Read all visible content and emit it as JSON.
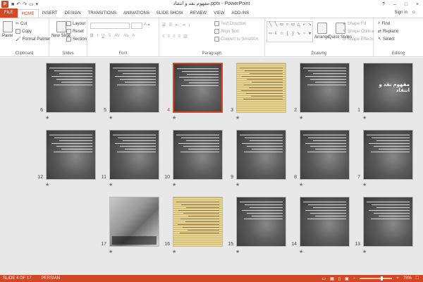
{
  "window": {
    "title": "مفهوم نقد و انتقاد.pptx - PowerPoint",
    "app_letter": "P",
    "controls": [
      "?",
      "–",
      "□",
      "×"
    ]
  },
  "ribbon_tabs": [
    "FILE",
    "HOME",
    "INSERT",
    "DESIGN",
    "TRANSITIONS",
    "ANIMATIONS",
    "SLIDE SHOW",
    "REVIEW",
    "VIEW",
    "ADD-INS"
  ],
  "active_tab": "HOME",
  "account": {
    "signin": "Sign in"
  },
  "clipboard": {
    "label": "Clipboard",
    "paste": "Paste",
    "cut": "Cut",
    "copy": "Copy",
    "format_painter": "Format Painter"
  },
  "slides_group": {
    "label": "Slides",
    "new_slide": "New Slide",
    "layout": "Layout",
    "reset": "Reset",
    "section": "Section"
  },
  "font_group": {
    "label": "Font"
  },
  "paragraph_group": {
    "label": "Paragraph",
    "text_direction": "Text Direction",
    "align_text": "Align Text",
    "convert_smartart": "Convert to SmartArt"
  },
  "drawing_group": {
    "label": "Drawing",
    "arrange": "Arrange",
    "quick_styles": "Quick Styles",
    "shape_fill": "Shape Fill",
    "shape_outline": "Shape Outline",
    "shape_effects": "Shape Effects"
  },
  "editing_group": {
    "label": "Editing",
    "find": "Find",
    "replace": "Replace",
    "select": "Select"
  },
  "slide_title_1": "مفهوم نقد و انتقاد",
  "slides": [
    {
      "n": "1",
      "kind": "title"
    },
    {
      "n": "2",
      "kind": "text"
    },
    {
      "n": "3",
      "kind": "parch"
    },
    {
      "n": "4",
      "kind": "text",
      "selected": true
    },
    {
      "n": "5",
      "kind": "text"
    },
    {
      "n": "6",
      "kind": "text"
    },
    {
      "n": "7",
      "kind": "text"
    },
    {
      "n": "8",
      "kind": "text"
    },
    {
      "n": "9",
      "kind": "text"
    },
    {
      "n": "10",
      "kind": "text"
    },
    {
      "n": "11",
      "kind": "text"
    },
    {
      "n": "12",
      "kind": "text"
    },
    {
      "n": "13",
      "kind": "text"
    },
    {
      "n": "14",
      "kind": "text"
    },
    {
      "n": "15",
      "kind": "text"
    },
    {
      "n": "16",
      "kind": "parch"
    },
    {
      "n": "17",
      "kind": "laptop"
    }
  ],
  "status": {
    "slide_of": "SLIDE 4 OF 17",
    "language": "PERSIAN",
    "zoom": "78%"
  },
  "colors": {
    "accent": "#d24726"
  }
}
